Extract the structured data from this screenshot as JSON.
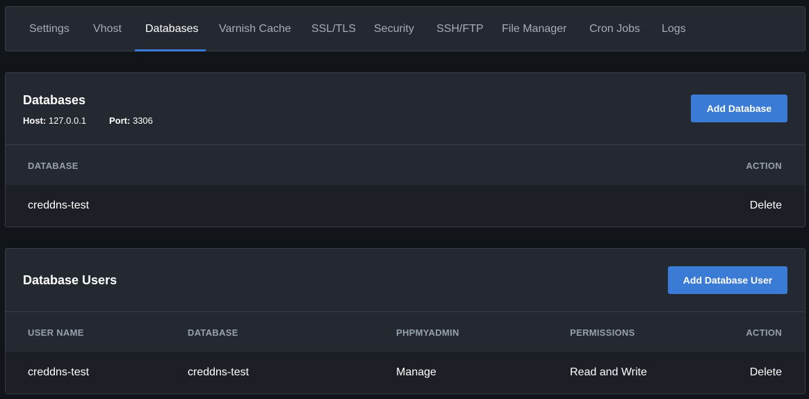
{
  "tabs": [
    "Settings",
    "Vhost",
    "Databases",
    "Varnish Cache",
    "SSL/TLS",
    "Security",
    "SSH/FTP",
    "File Manager",
    "Cron Jobs",
    "Logs"
  ],
  "active_tab": "Databases",
  "databases_panel": {
    "title": "Databases",
    "host_label": "Host:",
    "host_value": "127.0.0.1",
    "port_label": "Port:",
    "port_value": "3306",
    "add_button": "Add Database",
    "columns": [
      "DATABASE",
      "ACTION"
    ],
    "rows": [
      {
        "database": "creddns-test",
        "action": "Delete"
      }
    ]
  },
  "users_panel": {
    "title": "Database Users",
    "add_button": "Add Database User",
    "columns": [
      "USER NAME",
      "DATABASE",
      "PHPMYADMIN",
      "PERMISSIONS",
      "ACTION"
    ],
    "rows": [
      {
        "user_name": "creddns-test",
        "database": "creddns-test",
        "phpmyadmin": "Manage",
        "permissions": "Read and Write",
        "action": "Delete"
      }
    ]
  },
  "colors": {
    "accent": "#3a7bd5",
    "panel": "#242830",
    "background": "#111418"
  }
}
